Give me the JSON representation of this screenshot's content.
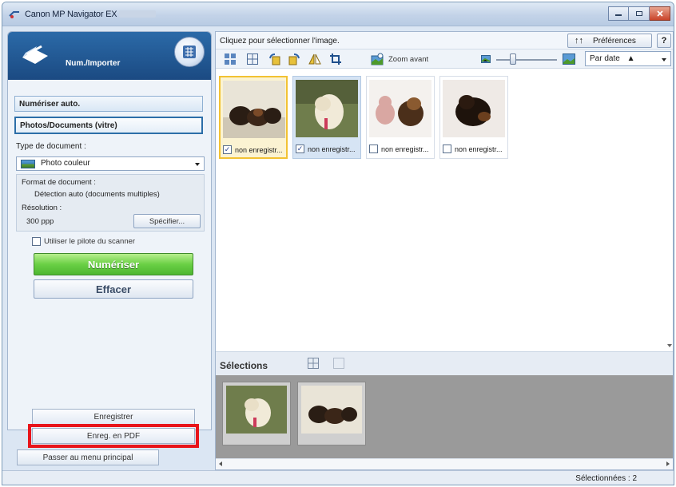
{
  "window": {
    "title": "Canon MP Navigator EX",
    "controls": [
      "minimize-icon",
      "restore-icon",
      "close-icon"
    ]
  },
  "mode": {
    "title": "Num./Importer",
    "icon": "scanner-icon",
    "switch_icon": "mode-switch-icon",
    "accent": "#1b4a82"
  },
  "sidebar": {
    "items": [
      {
        "label": "Numériser auto."
      },
      {
        "label": "Photos/Documents (vitre)"
      }
    ],
    "doc_type_label": "Type de document :",
    "doc_type_value": "Photo couleur",
    "doc_format_label": "Format de document :",
    "doc_format_value": "Détection auto (documents multiples)",
    "resolution_label": "Résolution :",
    "resolution_value": "300 ppp",
    "specify_label": "Spécifier...",
    "use_driver_label": "Utiliser le pilote du scanner",
    "use_driver_checked": false,
    "scan_label": "Numériser",
    "clear_label": "Effacer",
    "save_label": "Enregistrer",
    "save_pdf_label": "Enreg. en PDF",
    "main_menu_label": "Passer au menu principal",
    "scan_color": "#4db631",
    "highlight_color": "#e8141a"
  },
  "main": {
    "hint": "Cliquez pour sélectionner l'image.",
    "preferences_label": "Préférences",
    "help_label": "?",
    "toolbar": {
      "tools": [
        "thumbnail-view-icon",
        "grid-view-icon",
        "rotate-left-icon",
        "rotate-right-icon",
        "mirror-icon",
        "crop-icon",
        "zoom-icon"
      ],
      "zoom_label": "Zoom avant",
      "zoom_level": 0.28,
      "sort_value": "Par date"
    },
    "thumbnails": [
      {
        "caption": "non enregistr...",
        "checked": true,
        "state": "focused"
      },
      {
        "caption": "non enregistr...",
        "checked": true,
        "state": "selected"
      },
      {
        "caption": "non enregistr...",
        "checked": false,
        "state": "none"
      },
      {
        "caption": "non enregistr...",
        "checked": false,
        "state": "none"
      }
    ],
    "selections_label": "Sélections",
    "selected_count_label": "Sélectionnées : 2"
  }
}
